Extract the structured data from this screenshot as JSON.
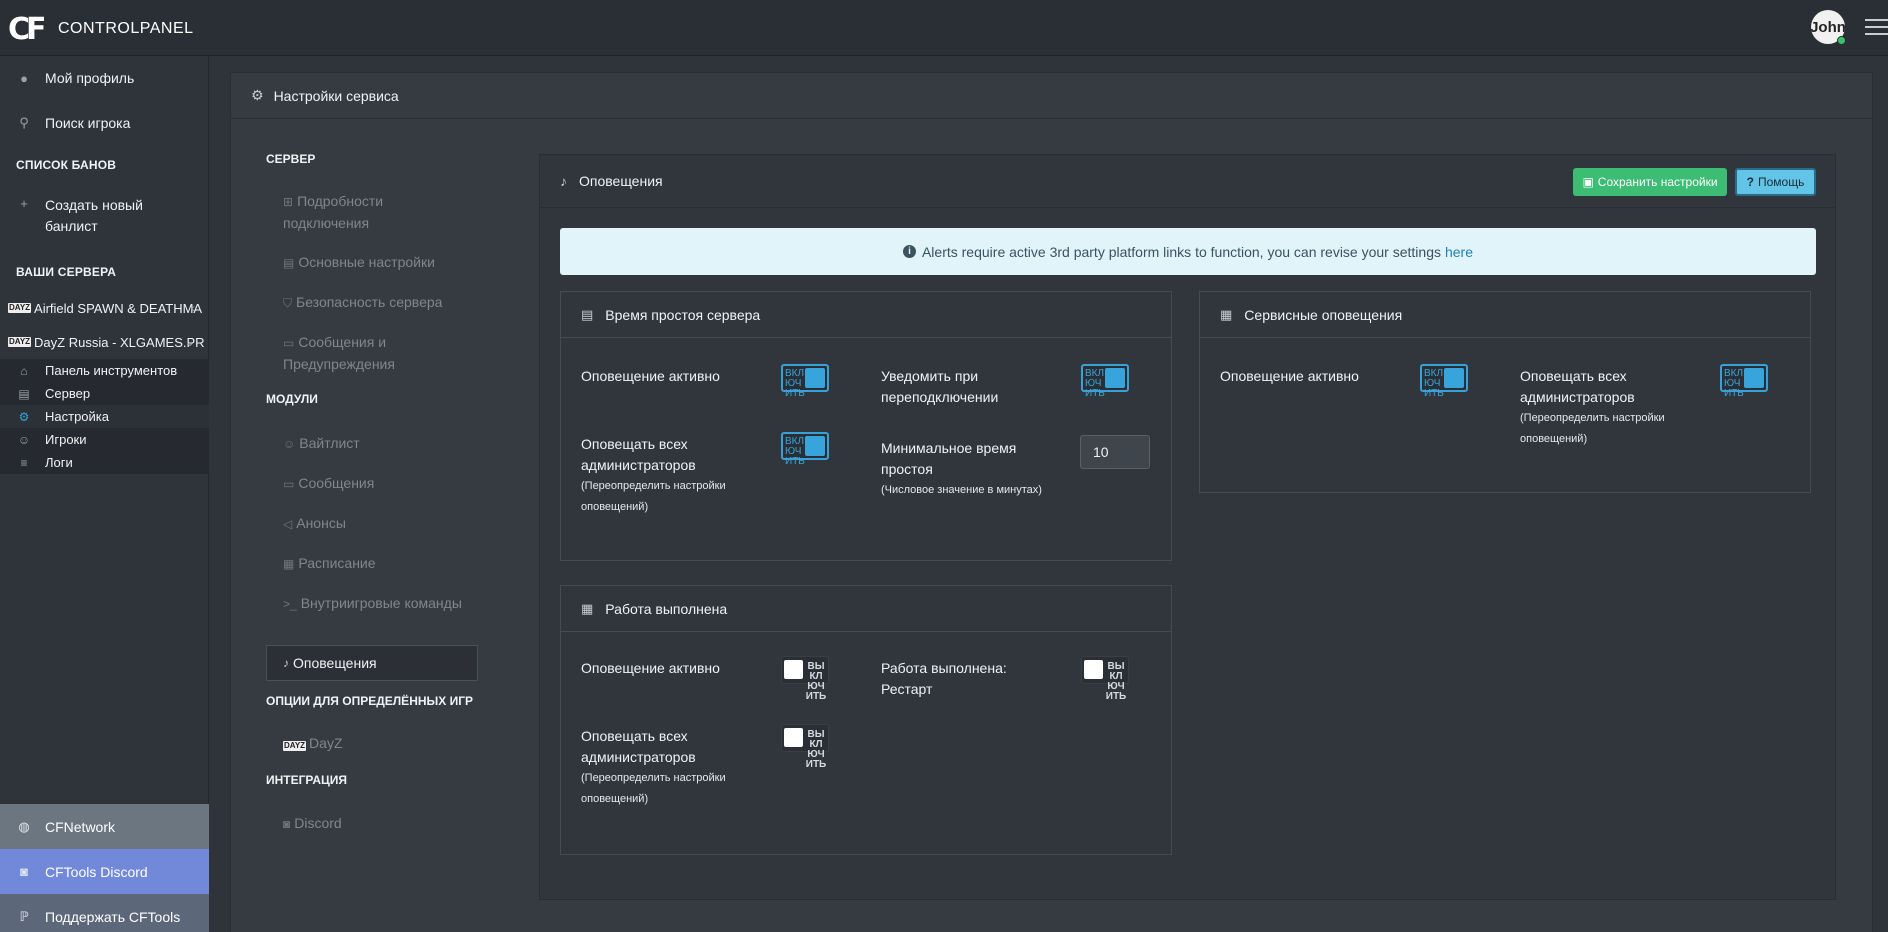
{
  "topbar": {
    "logo_mark": "CF",
    "logo_text": "CONTROLPANEL",
    "avatar_text": "John"
  },
  "sidebar": {
    "profile": "Мой профиль",
    "search_player": "Поиск игрока",
    "banlist_head": "СПИСОК БАНОВ",
    "create_banlist": "Создать новый банлист",
    "servers_head": "ВАШИ СЕРВЕРА",
    "servers": [
      {
        "badge": "DAYZ",
        "name": "Airfield SPAWN & DEATHMA",
        "chevron": "‹"
      },
      {
        "badge": "DAYZ",
        "name": "DayZ Russia - XLGAMES.PR",
        "chevron": "⌄"
      }
    ],
    "server_menu": [
      "Панель инструментов",
      "Сервер",
      "Настройка",
      "Игроки",
      "Логи"
    ],
    "footer": [
      "CFNetwork",
      "CFTools Discord",
      "Поддержать CFTools"
    ],
    "colors": {
      "cfnetwork": "#6c7680",
      "discord": "#7289da",
      "support": "#5c677a"
    }
  },
  "page": {
    "title": "Настройки сервиса"
  },
  "settings_nav": {
    "server_head": "СЕРВЕР",
    "server_items": [
      "Подробности подключения",
      "Основные настройки",
      "Безопасность сервера",
      "Сообщения и Предупреждения"
    ],
    "modules_head": "МОДУЛИ",
    "module_items": [
      "Вайтлист",
      "Сообщения",
      "Анонсы",
      "Расписание",
      "Внутриигровые команды"
    ],
    "active_item": "Оповещения",
    "games_head": "ОПЦИИ ДЛЯ ОПРЕДЕЛЁННЫХ ИГР",
    "game_item": "DayZ",
    "integration_head": "ИНТЕГРАЦИЯ",
    "integration_item": "Discord"
  },
  "alerts": {
    "title": "Оповещения",
    "save_label": "Сохранить настройки",
    "help_label": "Помощь",
    "info_text": "Alerts require active 3rd party platform links to function, you can revise your settings",
    "info_link": "here",
    "toggle_on": "ВКЛЮЧИТЬ",
    "toggle_off": "ВЫКЛЮЧИТЬ",
    "downtime": {
      "title": "Время простоя сервера",
      "active_label": "Оповещение активно",
      "active_on": true,
      "reconnect_label": "Уведомить при переподключении",
      "reconnect_on": true,
      "all_admins_label": "Оповещать всех администраторов",
      "all_admins_note": "(Переопределить настройки оповещений)",
      "all_admins_on": true,
      "min_time_label": "Минимальное время простоя",
      "min_time_note": "(Числовое значение в минутах)",
      "min_time_value": "10"
    },
    "service": {
      "title": "Сервисные оповещения",
      "active_label": "Оповещение активно",
      "active_on": true,
      "all_admins_label": "Оповещать всех администраторов",
      "all_admins_note": "(Переопределить настройки оповещений)",
      "all_admins_on": true
    },
    "job_done": {
      "title": "Работа выполнена",
      "active_label": "Оповещение активно",
      "active_on": false,
      "restart_label": "Работа выполнена: Рестарт",
      "restart_on": false,
      "all_admins_label": "Оповещать всех администраторов",
      "all_admins_note": "(Переопределить настройки оповещений)",
      "all_admins_on": false
    }
  }
}
